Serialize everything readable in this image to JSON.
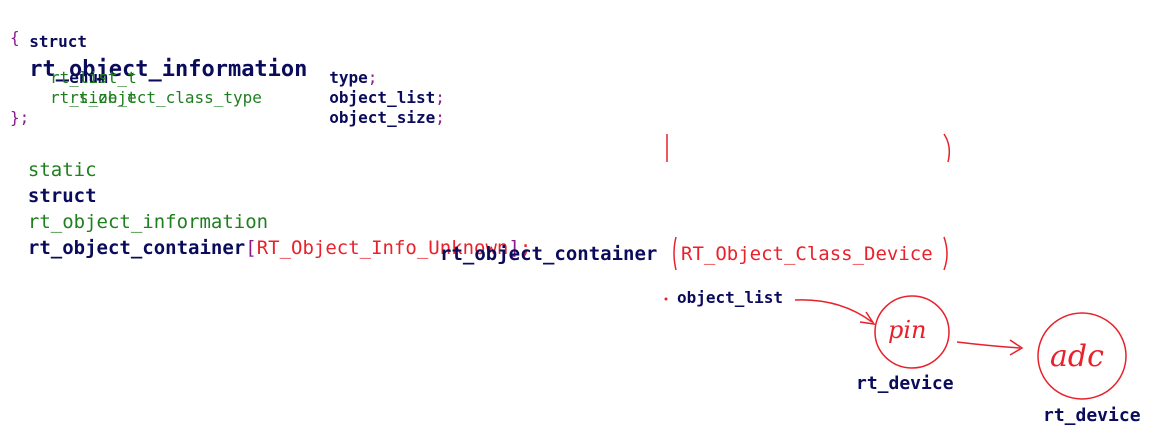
{
  "struct_decl": {
    "keyword": "struct",
    "name": "rt_object_information",
    "open_brace": "{",
    "close": "};",
    "fields": [
      {
        "type_kw": "enum",
        "type": "rt_object_class_type",
        "name": "type",
        "end": ";"
      },
      {
        "type_kw": "",
        "type": "rt_list_t",
        "name": "object_list",
        "end": ";"
      },
      {
        "type_kw": "",
        "type": "rt_size_t",
        "name": "object_size",
        "end": ";"
      }
    ]
  },
  "container_decl": {
    "static_kw": "static",
    "struct_kw": "struct",
    "type": "rt_object_information",
    "var": "rt_object_container",
    "open_bracket": "[",
    "index": "RT_Object_Info_Unknown",
    "close_bracket": "]",
    "semicolon": ";"
  },
  "diagram": {
    "container_label": "rt_object_container",
    "class_index": "RT_Object_Class_Device",
    "list_label": "object_list",
    "nodes": [
      {
        "text": "pin",
        "caption": "rt_device"
      },
      {
        "text": "adc",
        "caption": "rt_device"
      }
    ]
  },
  "colors": {
    "keyword": "#0b0b5c",
    "type": "#1f7f1f",
    "punctuation": "#8a1a8a",
    "annotation": "#e8212b"
  }
}
